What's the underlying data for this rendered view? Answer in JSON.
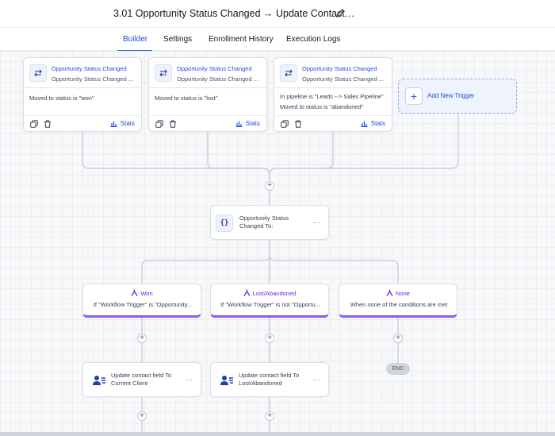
{
  "header": {
    "title": "3.01 Opportunity Status Changed → Update Contact…"
  },
  "tabs": [
    {
      "label": "Builder",
      "active": true
    },
    {
      "label": "Settings",
      "active": false
    },
    {
      "label": "Enrollment History",
      "active": false
    },
    {
      "label": "Execution Logs",
      "active": false
    }
  ],
  "triggers": [
    {
      "title": "Opportunity Status Changed",
      "subtitle": "Opportunity Status Changed ...",
      "conditions": [
        "Moved to status is \"won\""
      ],
      "stats_label": "Stats"
    },
    {
      "title": "Opportunity Status Changed",
      "subtitle": "Opportunity Status Changed ...",
      "conditions": [
        "Moved to status is \"lost\""
      ],
      "stats_label": "Stats"
    },
    {
      "title": "Opportunity Status Changed",
      "subtitle": "Opportunity Status Changed ...",
      "conditions": [
        "In pipeline is \"Leads --> Sales Pipeline\"",
        "Moved to status is \"abandoned\""
      ],
      "stats_label": "Stats"
    }
  ],
  "add_trigger": {
    "label": "Add New Trigger"
  },
  "if_else": {
    "icon_text": "{}",
    "label": "Opportunity Status Changed To:"
  },
  "branches": [
    {
      "name": "Won",
      "condition": "If \"Workflow Trigger\" is \"Opportunity..."
    },
    {
      "name": "Lost/Abandoned",
      "condition": "If \"Workflow Trigger\" is not \"Opportu..."
    },
    {
      "name": "None",
      "condition": "When none of the conditions are met"
    }
  ],
  "actions": [
    {
      "label": "Update contact field To Current Client"
    },
    {
      "label": "Update contact field To Lost/Abandoned"
    }
  ],
  "end_label": "END",
  "more_label": "...",
  "colors": {
    "accent": "#2563eb",
    "branch": "#8b5cf6",
    "line": "#c3c8d0"
  }
}
